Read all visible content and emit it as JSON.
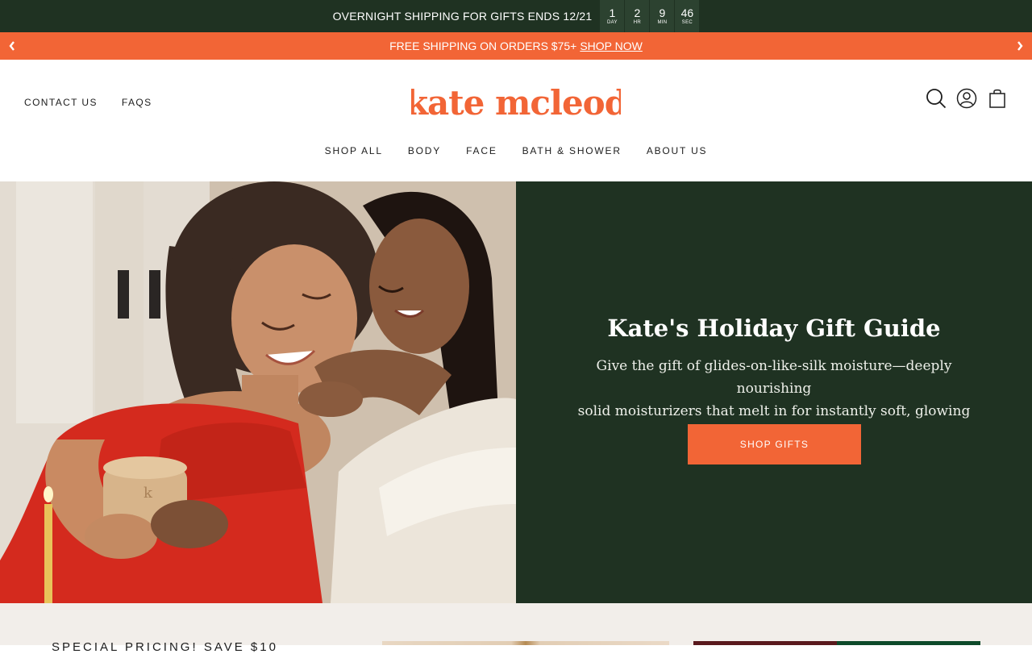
{
  "countdown_bar": {
    "text": "OVERNIGHT SHIPPING FOR GIFTS ENDS 12/21",
    "units": [
      {
        "value": "1",
        "label": "DAY"
      },
      {
        "value": "2",
        "label": "HR"
      },
      {
        "value": "9",
        "label": "MIN"
      },
      {
        "value": "46",
        "label": "SEC"
      }
    ]
  },
  "promo_bar": {
    "text": "FREE SHIPPING ON ORDERS $75+",
    "link": "SHOP NOW",
    "prev_icon": "chevron-left-icon",
    "next_icon": "chevron-right-icon"
  },
  "header": {
    "util_links": [
      "CONTACT US",
      "FAQS"
    ],
    "logo_text": "kate mcleod",
    "icons": [
      "search-icon",
      "account-icon",
      "cart-icon"
    ],
    "nav": [
      "SHOP ALL",
      "BODY",
      "FACE",
      "BATH & SHOWER",
      "ABOUT US"
    ]
  },
  "hero": {
    "title": "Kate's Holiday Gift Guide",
    "subtitle_line1": "Give the gift of glides-on-like-silk moisture—deeply nourishing",
    "subtitle_line2": "solid moisturizers that melt in for instantly soft, glowing skin.",
    "cta": "SHOP GIFTS"
  },
  "below": {
    "heading": "SPECIAL PRICING! SAVE $10"
  },
  "colors": {
    "dark_green": "#1f3222",
    "countdown_cell": "#2c4230",
    "brand_orange": "#f26536",
    "below_bg": "#f2eeea"
  }
}
